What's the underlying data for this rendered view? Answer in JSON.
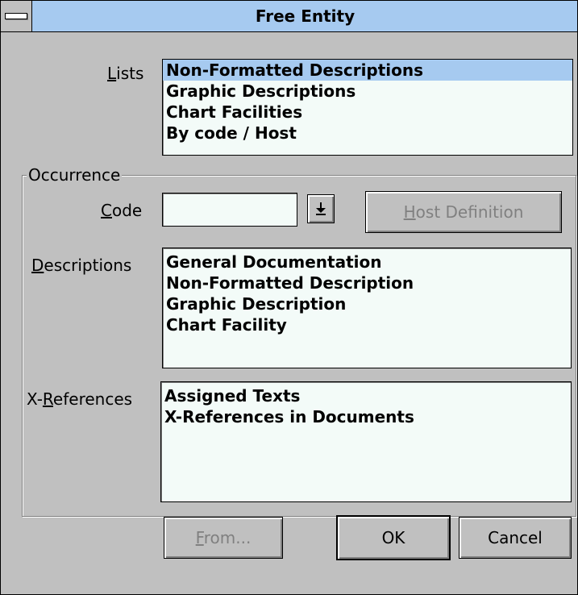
{
  "window": {
    "title": "Free Entity"
  },
  "lists": {
    "label_pre": "",
    "label_u": "L",
    "label_post": "ists",
    "items": [
      "Non-Formatted Descriptions",
      "Graphic Descriptions",
      "Chart Facilities",
      "By code / Host"
    ],
    "selected_index": 0
  },
  "occurrence": {
    "group_label": "Occurrence",
    "code": {
      "label_u": "C",
      "label_post": "ode",
      "value": ""
    },
    "host_button": {
      "label_u": "H",
      "label_post": "ost Definition",
      "enabled": false
    },
    "descriptions": {
      "label_u": "D",
      "label_post": "escriptions",
      "items": [
        "General Documentation",
        "Non-Formatted Description",
        "Graphic Description",
        "Chart Facility"
      ]
    },
    "xrefs": {
      "label_pre": "X-",
      "label_u": "R",
      "label_post": "eferences",
      "items": [
        "Assigned Texts",
        "X-References in Documents"
      ]
    }
  },
  "buttons": {
    "from": {
      "label_u": "F",
      "label_post": "rom...",
      "enabled": false
    },
    "ok": {
      "label": "OK"
    },
    "cancel": {
      "label": "Cancel"
    }
  },
  "colors": {
    "title_bar": "#a6caf0",
    "selection": "#a6caf0",
    "face": "#c0c0c0",
    "list_bg": "#f3fbf8",
    "disabled_text": "#808080"
  }
}
